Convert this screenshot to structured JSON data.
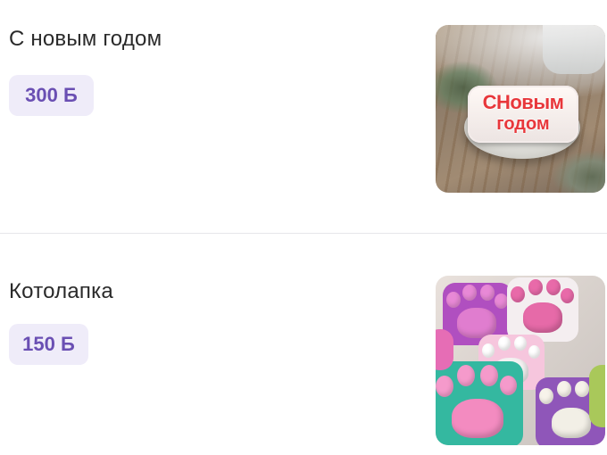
{
  "products": [
    {
      "title": "С новым годом",
      "price": "300 Б",
      "image": {
        "text_line1": "СНовым",
        "text_line2": "годом"
      }
    },
    {
      "title": "Котолапка",
      "price": "150 Б"
    }
  ],
  "colors": {
    "price_bg": "#efecf9",
    "price_text": "#6a4fb3",
    "divider": "#e6e6ea"
  }
}
